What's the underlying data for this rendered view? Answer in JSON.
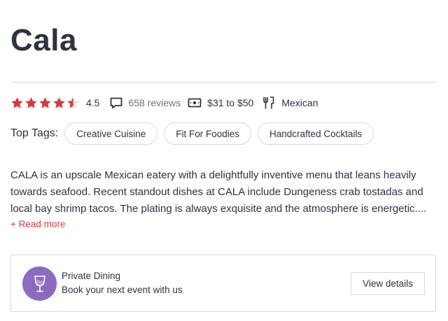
{
  "restaurant": {
    "name": "Cala",
    "rating": {
      "value_label": "4.5",
      "stars_filled": 4.5,
      "stars_total": 5,
      "star_color": "#da3743",
      "empty_star_color": "#e1e1e1"
    },
    "reviews_label": "658 reviews",
    "price_label": "$31 to $50",
    "cuisine_label": "Mexican"
  },
  "tags": {
    "label": "Top Tags:",
    "items": [
      "Creative Cuisine",
      "Fit For Foodies",
      "Handcrafted Cocktails"
    ]
  },
  "description": {
    "text": "CALA is an upscale Mexican eatery with a delightfully inventive menu that leans heavily towards seafood. Recent standout dishes at CALA include Dungeness crab tostadas and local bay shrimp tacos. The plating is always exquisite and the atmosphere is energetic....",
    "read_more_label": "+ Read more"
  },
  "private_dining": {
    "title": "Private Dining",
    "subtitle": "Book your next event with us",
    "button_label": "View details",
    "icon_bg": "#8b6bbf"
  },
  "icons": {
    "star": "star-icon",
    "reviews": "speech-bubble-icon",
    "price": "money-icon",
    "cuisine": "fork-knife-icon",
    "private_dining": "wine-glass-icon"
  }
}
